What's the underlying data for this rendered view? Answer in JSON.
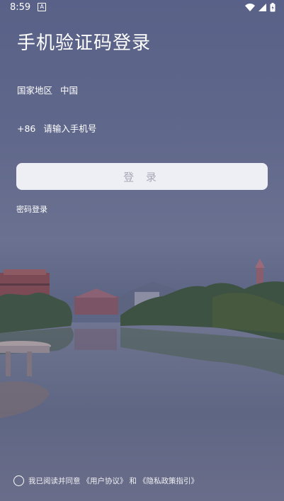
{
  "status_bar": {
    "time": "8:59",
    "notification_icon": "A",
    "icons": [
      "wifi-icon",
      "signal-icon",
      "battery-icon"
    ]
  },
  "page": {
    "title": "手机验证码登录"
  },
  "region": {
    "label": "国家地区",
    "value": "中国"
  },
  "phone": {
    "country_code": "+86",
    "placeholder": "请输入手机号",
    "value": ""
  },
  "login_button": {
    "label": "登 录"
  },
  "password_login_link": "密码登录",
  "agreement": {
    "prefix": "我已阅读并同意",
    "user_agreement": "《用户协议》",
    "conjunction": "和",
    "privacy_policy": "《隐私政策指引》"
  },
  "colors": {
    "button_bg": "#eeeff4",
    "button_text": "#a7a9b6",
    "text": "#ffffff"
  }
}
